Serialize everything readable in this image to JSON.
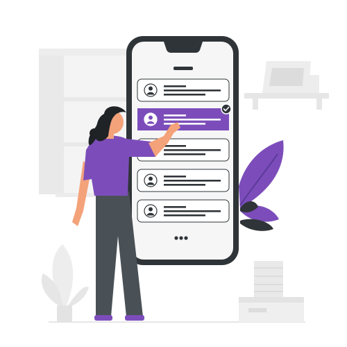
{
  "colors": {
    "accent": "#7c4dba",
    "accent_dark": "#5b3a9a",
    "phone_frame": "#2f3438",
    "screen_bg": "#f6f6f6",
    "card_bg": "#ffffff",
    "card_line": "#2f3438",
    "background_grey": "#ececec",
    "skin": "#f4a27a",
    "pants": "#4a5156",
    "hair": "#1f2326"
  },
  "phone": {
    "list_items": [
      {
        "selected": false
      },
      {
        "selected": true
      },
      {
        "selected": false
      },
      {
        "selected": false
      },
      {
        "selected": false
      }
    ],
    "more_indicator": "more-dots"
  },
  "icons": [
    "user-avatar-icon",
    "check-badge-icon",
    "more-dots-icon"
  ]
}
